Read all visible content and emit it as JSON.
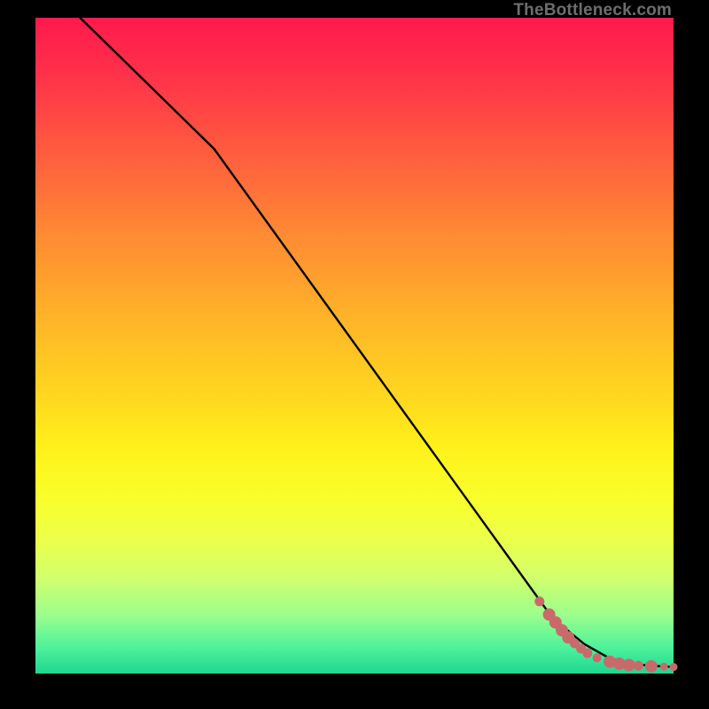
{
  "watermark": "TheBottleneck.com",
  "chart_data": {
    "type": "line",
    "title": "",
    "xlabel": "",
    "ylabel": "",
    "xlim": [
      0,
      100
    ],
    "ylim": [
      0,
      100
    ],
    "background": "vertical red-yellow-green gradient",
    "curve": {
      "name": "bottleneck-curve",
      "x": [
        7,
        28,
        81,
        86,
        90,
        94,
        98,
        100
      ],
      "y": [
        100,
        80,
        8.5,
        4.5,
        2.3,
        1.4,
        1.1,
        1.0
      ]
    },
    "points": {
      "name": "data-points",
      "color": "#c96a6a",
      "radius_default": 5.5,
      "coords": [
        {
          "x": 79.0,
          "y": 11.0,
          "r": 5.5
        },
        {
          "x": 80.5,
          "y": 9.0,
          "r": 7
        },
        {
          "x": 81.5,
          "y": 7.8,
          "r": 7
        },
        {
          "x": 82.5,
          "y": 6.6,
          "r": 7
        },
        {
          "x": 83.5,
          "y": 5.5,
          "r": 7
        },
        {
          "x": 84.5,
          "y": 4.6,
          "r": 5.5
        },
        {
          "x": 85.5,
          "y": 3.8,
          "r": 5.5
        },
        {
          "x": 86.5,
          "y": 3.1,
          "r": 5.5
        },
        {
          "x": 88.0,
          "y": 2.4,
          "r": 5
        },
        {
          "x": 90.0,
          "y": 1.8,
          "r": 7
        },
        {
          "x": 91.5,
          "y": 1.5,
          "r": 7
        },
        {
          "x": 93.0,
          "y": 1.3,
          "r": 7
        },
        {
          "x": 94.5,
          "y": 1.2,
          "r": 5.5
        },
        {
          "x": 96.5,
          "y": 1.1,
          "r": 7
        },
        {
          "x": 98.5,
          "y": 1.05,
          "r": 4.5
        },
        {
          "x": 100.0,
          "y": 1.0,
          "r": 4.5
        }
      ]
    }
  }
}
